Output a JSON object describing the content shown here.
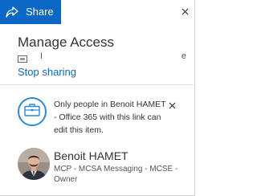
{
  "header": {
    "title": "Share",
    "share_icon": "share-arrow-icon",
    "close_icon": "close-icon",
    "background_color": "#0a67c4"
  },
  "manage_access": {
    "title": "Manage Access",
    "permission_icon": "link-permission-icon",
    "permission_text": "I",
    "permission_tail": "e",
    "stop_sharing_label": "Stop sharing",
    "link_color": "#0a67c4"
  },
  "info_banner": {
    "icon": "briefcase-icon",
    "text": "Only people in Benoit HAMET - Office 365 with this link can edit this item.",
    "close_icon": "close-icon",
    "icon_color": "#2a8ad8"
  },
  "person": {
    "avatar": "user-avatar",
    "name": "Benoit HAMET",
    "description": "MCP - MCSA Messaging - MCSE -",
    "role": "Owner"
  }
}
